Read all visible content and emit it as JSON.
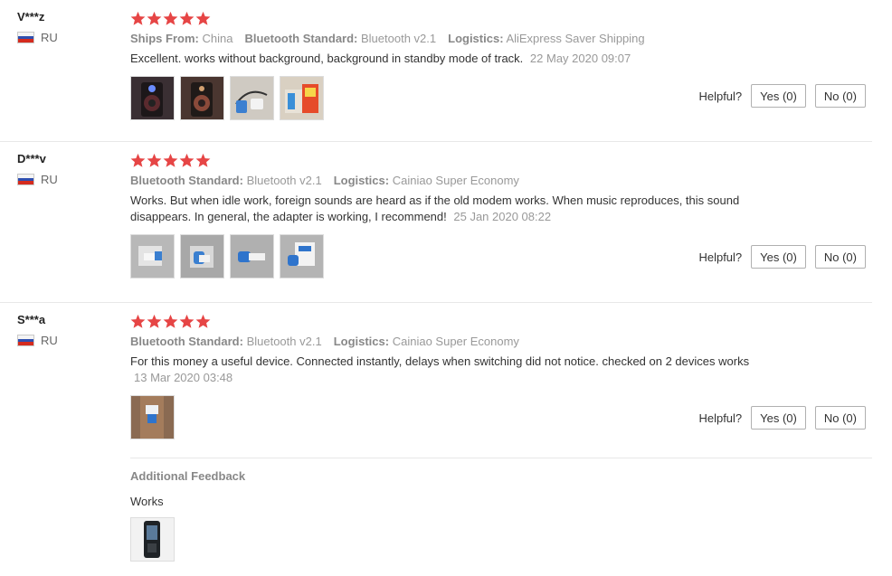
{
  "rating_color": "#e64545",
  "reviews": [
    {
      "user": "V***z",
      "country": "RU",
      "stars": 5,
      "meta": [
        {
          "key": "Ships From:",
          "value": "China"
        },
        {
          "key": "Bluetooth Standard:",
          "value": "Bluetooth v2.1"
        },
        {
          "key": "Logistics:",
          "value": "AliExpress Saver Shipping"
        }
      ],
      "text": "Excellent. works without background, background in standby mode of track.",
      "date": "22 May 2020 09:07",
      "photos": [
        "speaker-photo",
        "speaker-photo",
        "earphones-adapter-photo",
        "adapter-package-photo"
      ],
      "helpful_label": "Helpful?",
      "yes_label": "Yes (0)",
      "no_label": "No (0)"
    },
    {
      "user": "D***v",
      "country": "RU",
      "stars": 5,
      "meta": [
        {
          "key": "Bluetooth Standard:",
          "value": "Bluetooth v2.1"
        },
        {
          "key": "Logistics:",
          "value": "Cainiao Super Economy"
        }
      ],
      "text": "Works. But when idle work, foreign sounds are heard as if the old modem works. When music reproduces, this sound disappears. In general, the adapter is working, I recommend!",
      "date": "25 Jan 2020 08:22",
      "photos": [
        "adapter-photo",
        "adapter-photo",
        "adapter-photo",
        "adapter-photo"
      ],
      "helpful_label": "Helpful?",
      "yes_label": "Yes (0)",
      "no_label": "No (0)"
    },
    {
      "user": "S***a",
      "country": "RU",
      "stars": 5,
      "meta": [
        {
          "key": "Bluetooth Standard:",
          "value": "Bluetooth v2.1"
        },
        {
          "key": "Logistics:",
          "value": "Cainiao Super Economy"
        }
      ],
      "text": "For this money a useful device. Connected instantly, delays when switching did not notice. checked on 2 devices works",
      "date": "13 Mar 2020 03:48",
      "photos": [
        "adapter-hand-photo"
      ],
      "helpful_label": "Helpful?",
      "yes_label": "Yes (0)",
      "no_label": "No (0)",
      "additional": {
        "title": "Additional Feedback",
        "text": "Works",
        "photos": [
          "player-photo"
        ]
      }
    }
  ]
}
